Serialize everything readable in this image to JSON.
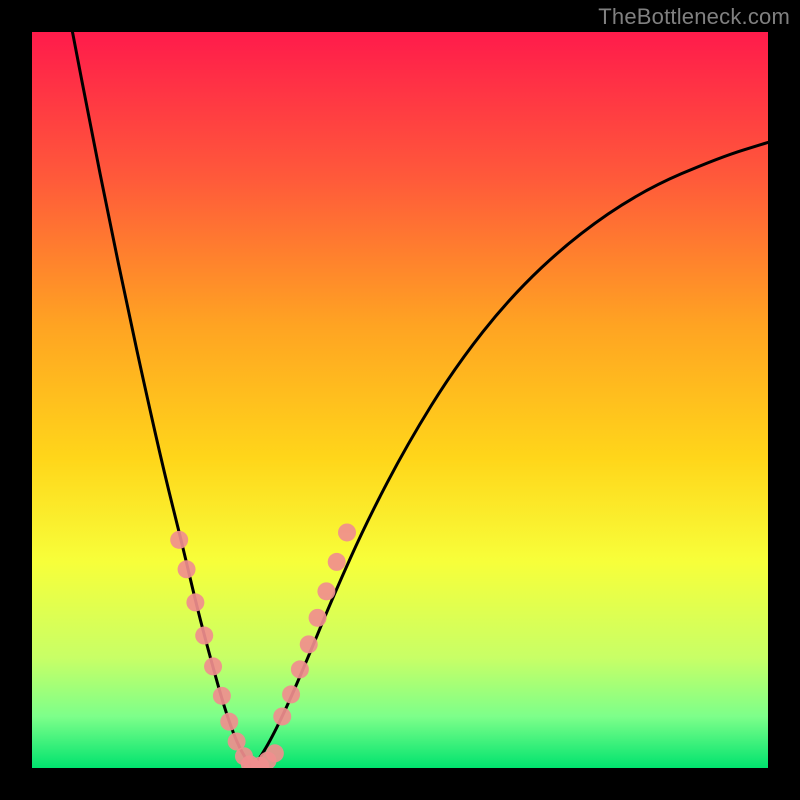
{
  "watermark": "TheBottleneck.com",
  "chart_data": {
    "type": "line",
    "note": "Bottleneck-style V-curve over a vertical rainbow gradient. Minimum of the curve sits near x≈0.30 on a 0–1 horizontal domain. Pink dots highlight the near-minimum region on both branches.",
    "x_domain": [
      0,
      1
    ],
    "y_domain": [
      0,
      1
    ],
    "gradient_stops": [
      {
        "offset": 0.0,
        "color": "#ff1b4b"
      },
      {
        "offset": 0.2,
        "color": "#ff5a3a"
      },
      {
        "offset": 0.4,
        "color": "#ffa422"
      },
      {
        "offset": 0.58,
        "color": "#ffd61a"
      },
      {
        "offset": 0.72,
        "color": "#f7ff3a"
      },
      {
        "offset": 0.85,
        "color": "#c8ff66"
      },
      {
        "offset": 0.93,
        "color": "#7dff8a"
      },
      {
        "offset": 1.0,
        "color": "#00e36e"
      }
    ],
    "series": [
      {
        "name": "left-branch",
        "x": [
          0.055,
          0.08,
          0.105,
          0.13,
          0.155,
          0.18,
          0.205,
          0.225,
          0.245,
          0.262,
          0.278,
          0.292,
          0.3
        ],
        "y": [
          1.0,
          0.87,
          0.745,
          0.625,
          0.51,
          0.4,
          0.3,
          0.215,
          0.14,
          0.08,
          0.035,
          0.01,
          0.0
        ]
      },
      {
        "name": "right-branch",
        "x": [
          0.3,
          0.32,
          0.345,
          0.375,
          0.41,
          0.455,
          0.51,
          0.575,
          0.65,
          0.735,
          0.83,
          0.935,
          1.0
        ],
        "y": [
          0.0,
          0.03,
          0.08,
          0.15,
          0.235,
          0.335,
          0.44,
          0.545,
          0.64,
          0.72,
          0.785,
          0.83,
          0.85
        ]
      }
    ],
    "marker_series": [
      {
        "name": "left-markers",
        "x": [
          0.2,
          0.21,
          0.222,
          0.234,
          0.246,
          0.258,
          0.268,
          0.278,
          0.288,
          0.296
        ],
        "y": [
          0.31,
          0.27,
          0.225,
          0.18,
          0.138,
          0.098,
          0.063,
          0.036,
          0.016,
          0.005
        ]
      },
      {
        "name": "bottom-markers",
        "x": [
          0.3,
          0.31,
          0.32,
          0.33
        ],
        "y": [
          0.0,
          0.003,
          0.01,
          0.02
        ]
      },
      {
        "name": "right-markers",
        "x": [
          0.34,
          0.352,
          0.364,
          0.376,
          0.388,
          0.4,
          0.414,
          0.428
        ],
        "y": [
          0.07,
          0.1,
          0.134,
          0.168,
          0.204,
          0.24,
          0.28,
          0.32
        ]
      }
    ],
    "marker_color": "#f08e8e",
    "curve_color": "#000000",
    "curve_width": 3,
    "marker_radius": 9
  }
}
